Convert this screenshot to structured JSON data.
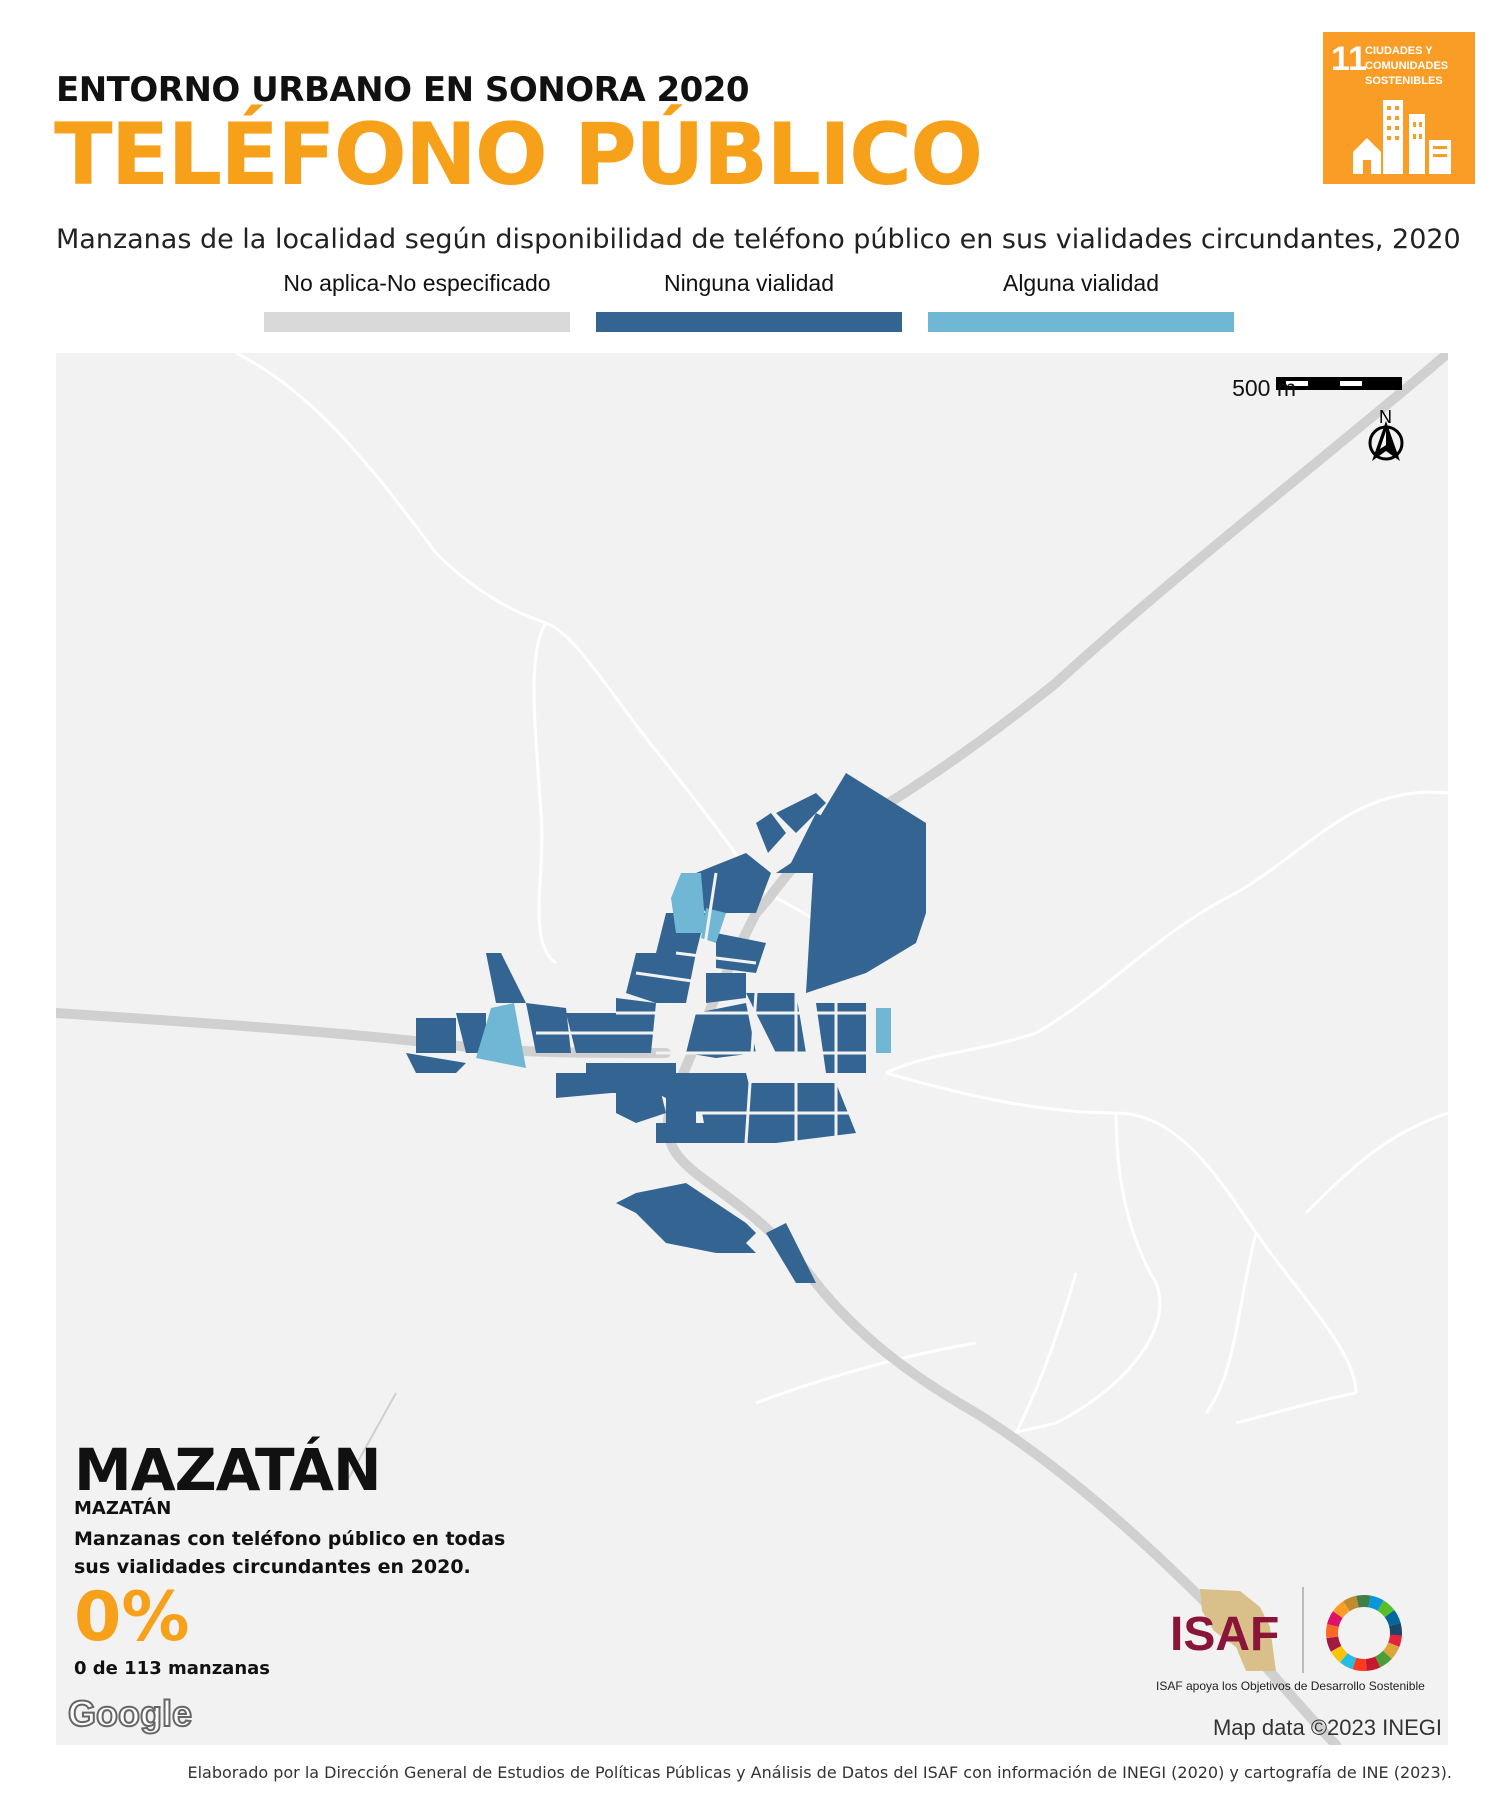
{
  "header": {
    "kicker": "ENTORNO URBANO EN SONORA 2020",
    "title": "TELÉFONO PÚBLICO",
    "subtitle": "Manzanas de la localidad según disponibilidad de teléfono público en sus vialidades circundantes, 2020"
  },
  "sdg_badge": {
    "number": "11",
    "text": "CIUDADES Y COMUNIDADES SOSTENIBLES",
    "color": "#f99d26"
  },
  "legend": [
    {
      "label": "No aplica-No especificado",
      "color": "#d9d9d9"
    },
    {
      "label": "Ninguna vialidad",
      "color": "#346592"
    },
    {
      "label": "Alguna vialidad",
      "color": "#6fb7d4"
    }
  ],
  "map": {
    "scale_label": "500 m",
    "north_label": "N",
    "attribution": "Map data ©2023 INEGI",
    "google_logo": "Google"
  },
  "place": {
    "municipality": "MAZATÁN",
    "locality": "MAZATÁN"
  },
  "stat": {
    "description": "Manzanas con teléfono público en todas sus vialidades circundantes en 2020.",
    "percent": "0%",
    "count": "0 de 113 manzanas"
  },
  "logos": {
    "isaf": "ISAF",
    "isaf_tagline": "ISAF apoya los Objetivos de Desarrollo Sostenible"
  },
  "footer": "Elaborado por la Dirección General de Estudios de Políticas Públicas y Análisis de Datos del ISAF con información de INEGI (2020) y cartografía de INE (2023)."
}
